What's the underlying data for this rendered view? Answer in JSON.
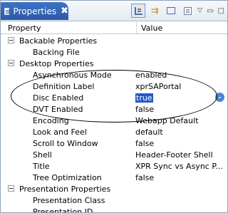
{
  "view": {
    "tab_label": "Properties",
    "close_glyph": "✖",
    "toolbar": [
      "categories-icon",
      "filter-advanced-icon",
      "restore-default-icon",
      "view-menu-icon"
    ]
  },
  "columns": {
    "property": "Property",
    "value": "Value"
  },
  "rows": [
    {
      "kind": "category",
      "name": "Backable Properties"
    },
    {
      "kind": "property",
      "name": "Backing File",
      "value": ""
    },
    {
      "kind": "category",
      "name": "Desktop Properties"
    },
    {
      "kind": "property",
      "name": "Asynchronous Mode",
      "value": "enabled"
    },
    {
      "kind": "property",
      "name": "Definition Label",
      "value": "xprSAPortal"
    },
    {
      "kind": "property",
      "name": "Disc Enabled",
      "value": "true",
      "selected": true
    },
    {
      "kind": "property",
      "name": "DVT Enabled",
      "value": "false"
    },
    {
      "kind": "property",
      "name": "Encoding",
      "value": "Webapp Default"
    },
    {
      "kind": "property",
      "name": "Look and Feel",
      "value": "default"
    },
    {
      "kind": "property",
      "name": "Scroll to Window",
      "value": "false"
    },
    {
      "kind": "property",
      "name": "Shell",
      "value": "Header-Footer Shell"
    },
    {
      "kind": "property",
      "name": "Title",
      "value": "XPR Sync vs Async P..."
    },
    {
      "kind": "property",
      "name": "Tree Optimization",
      "value": "false"
    },
    {
      "kind": "category",
      "name": "Presentation Properties"
    },
    {
      "kind": "property",
      "name": "Presentation Class",
      "value": ""
    },
    {
      "kind": "property",
      "name": "Presentation ID",
      "value": ""
    }
  ],
  "colors": {
    "tab": "#2d5aa6",
    "selection": "#2458c7",
    "annotation": "#000000"
  }
}
